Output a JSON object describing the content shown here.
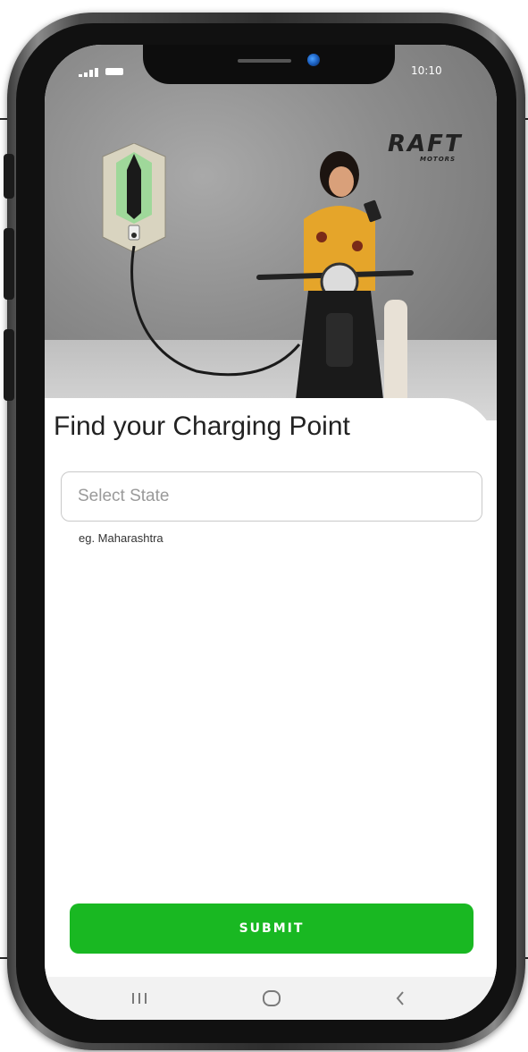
{
  "status_bar": {
    "time": "10:10"
  },
  "hero": {
    "brand_name": "RAFT",
    "brand_sub": "MOTORS"
  },
  "form": {
    "title": "Find your Charging Point",
    "state_placeholder": "Select State",
    "state_value": "",
    "hint": "eg. Maharashtra",
    "submit_label": "SUBMIT"
  },
  "nav": {
    "recents_icon": "recents-icon",
    "home_icon": "home-icon",
    "back_icon": "back-icon"
  },
  "colors": {
    "submit": "#19b822",
    "title_text": "#222222",
    "input_border": "#c9c9c9"
  }
}
